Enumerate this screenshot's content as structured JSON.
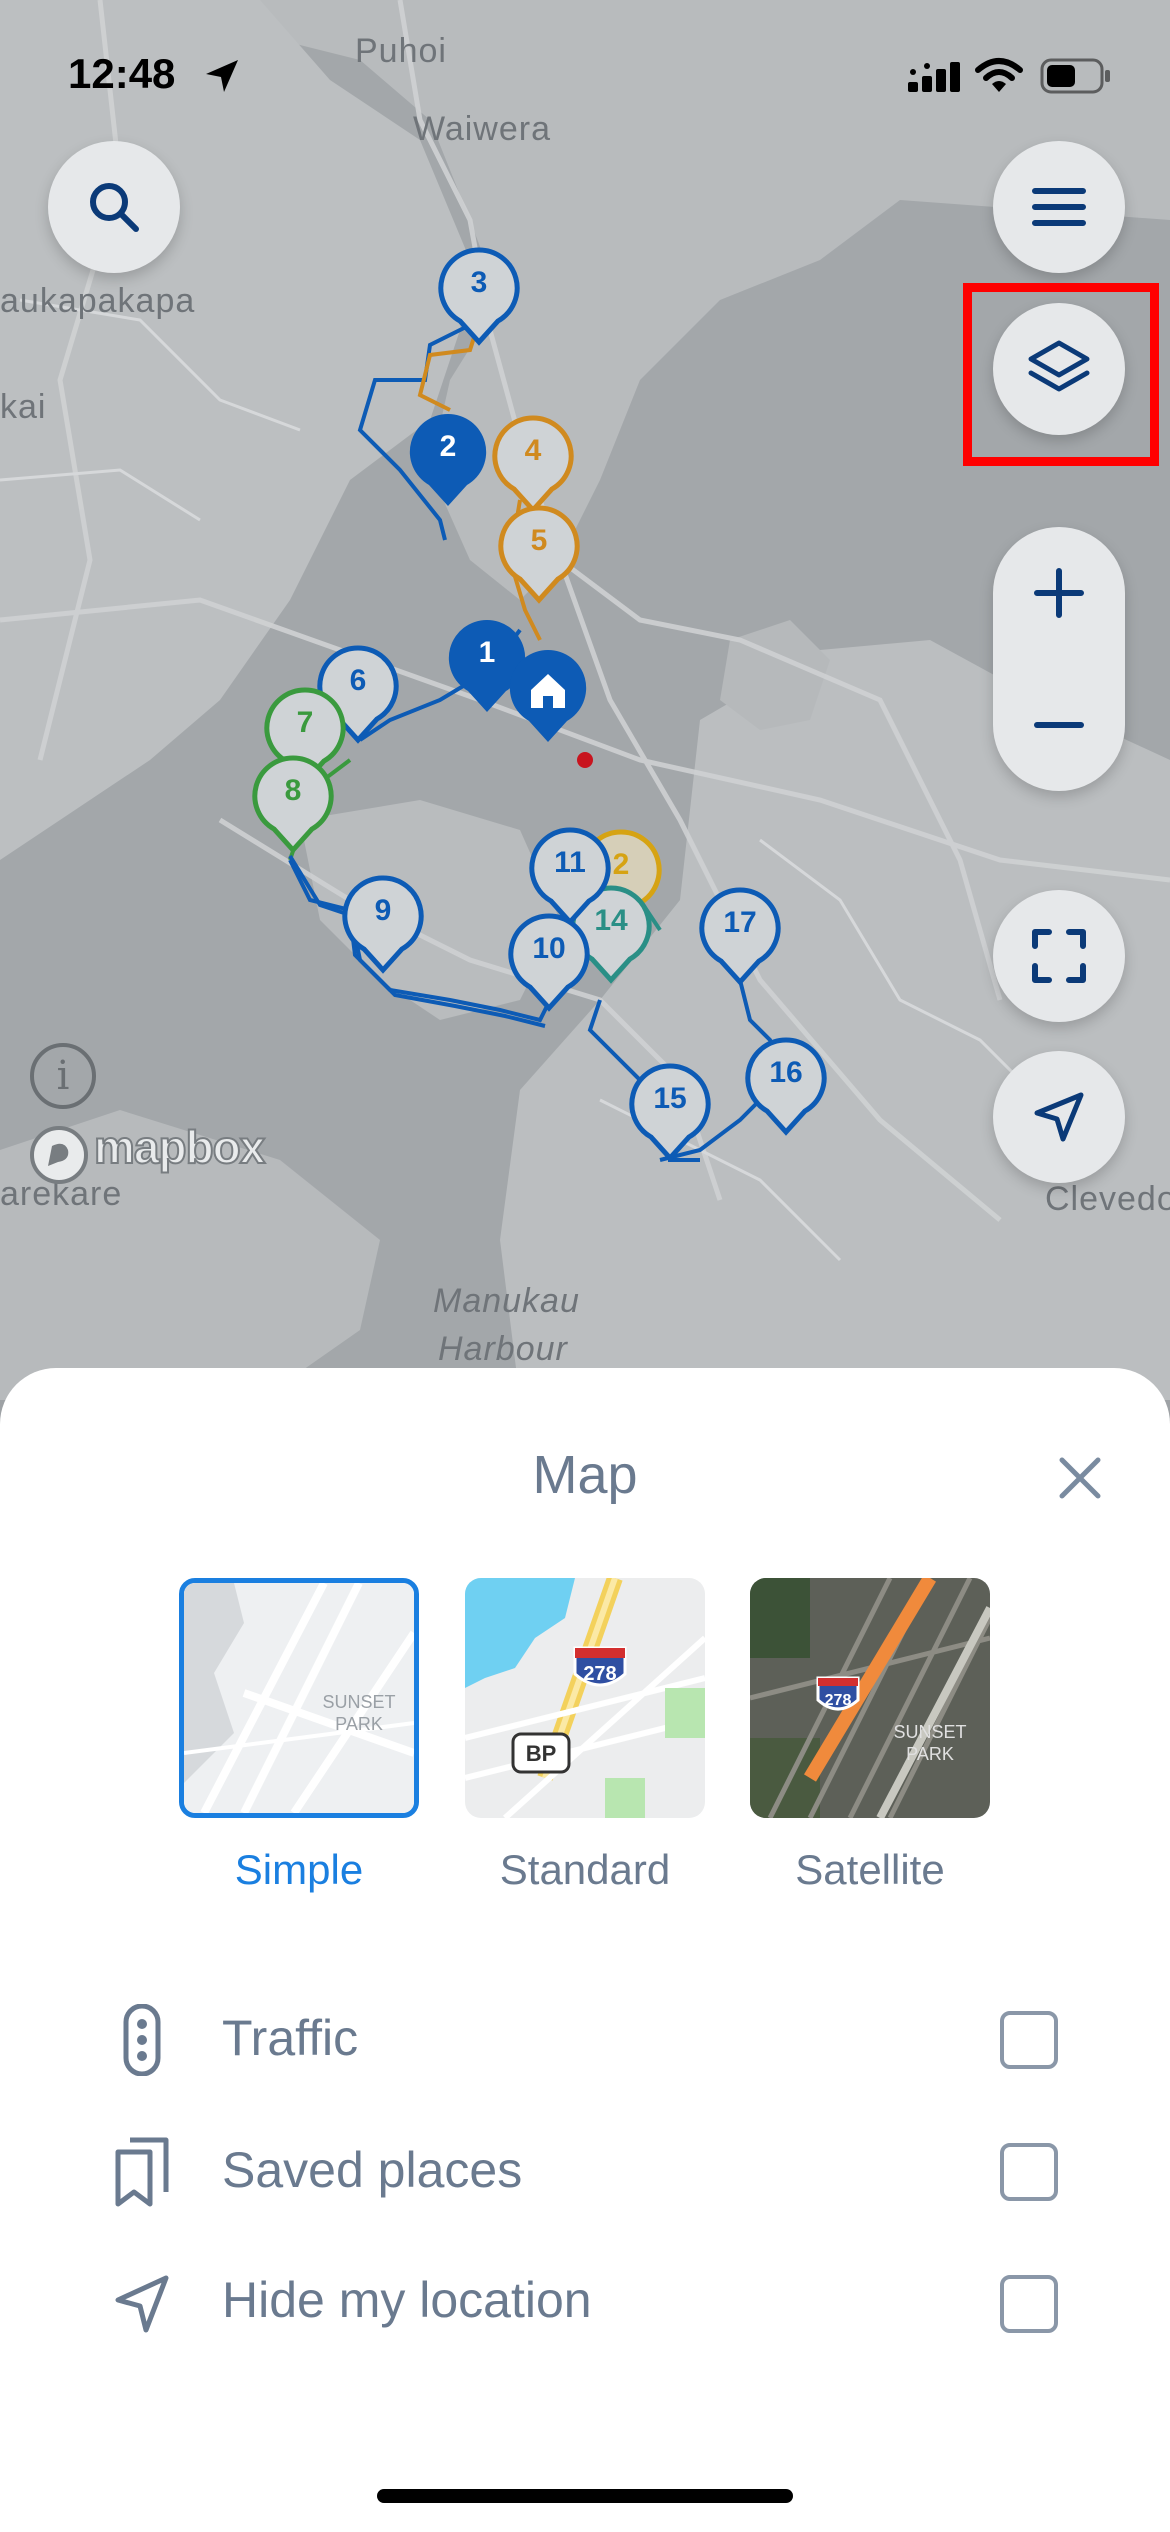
{
  "status_bar": {
    "time": "12:48"
  },
  "map": {
    "place_labels": {
      "puhoi": "Puhoi",
      "waiwera": "Waiwera",
      "kaukapakapa": "aukapakapa",
      "kai": "kai",
      "arekare": "arekare",
      "clevedon": "Clevedo",
      "manukau_1": "Manukau",
      "manukau_2": "Harbour"
    },
    "attribution_icon": "info-icon",
    "logo_text": "mapbox",
    "pins": {
      "p1": "1",
      "p2": "2",
      "p3": "3",
      "p4": "4",
      "p5": "5",
      "p6": "6",
      "p7": "7",
      "p8": "8",
      "p9": "9",
      "p10": "10",
      "p11": "11",
      "p12": "2",
      "p14": "14",
      "p15": "15",
      "p16": "16",
      "p17": "17"
    },
    "colors": {
      "blue": "#0d5bb5",
      "orange": "#d08a1f",
      "green": "#3a9a3e",
      "teal": "#2a8f86",
      "yellow": "#d6a313",
      "highlight": "#ff0000"
    }
  },
  "sheet": {
    "title": "Map",
    "map_types": [
      {
        "label": "Simple",
        "selected": true
      },
      {
        "label": "Standard",
        "selected": false
      },
      {
        "label": "Satellite",
        "selected": false
      }
    ],
    "thumb_text": {
      "sunset": "SUNSET",
      "park": "PARK",
      "shield": "278",
      "bp": "BP"
    },
    "options": [
      {
        "label": "Traffic",
        "checked": false
      },
      {
        "label": "Saved places",
        "checked": false
      },
      {
        "label": "Hide my location",
        "checked": false
      }
    ],
    "accent": "#1a7fe0"
  }
}
